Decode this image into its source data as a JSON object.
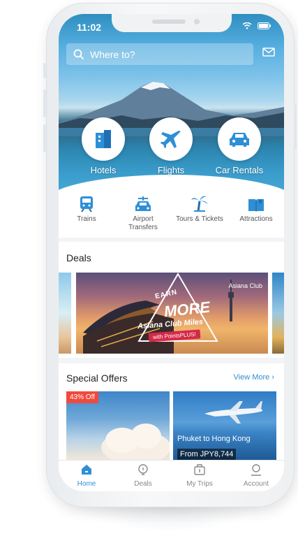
{
  "status": {
    "time": "11:02"
  },
  "search": {
    "placeholder": "Where to?"
  },
  "categories": [
    {
      "label": "Hotels",
      "icon": "hotel-icon"
    },
    {
      "label": "Flights",
      "icon": "plane-icon"
    },
    {
      "label": "Car Rentals",
      "icon": "car-icon"
    }
  ],
  "subcategories": [
    {
      "label": "Trains",
      "icon": "train-icon"
    },
    {
      "label": "Airport\nTransfers",
      "icon": "airport-transfer-icon"
    },
    {
      "label": "Tours & Tickets",
      "icon": "palm-tree-icon"
    },
    {
      "label": "Attractions",
      "icon": "map-book-icon"
    }
  ],
  "deals": {
    "title": "Deals",
    "banner": {
      "earn": "EARN",
      "more": "MORE",
      "headline": "Asiana Club Miles",
      "tag": "with PointsPLUS!",
      "brand": "Asiana Club"
    }
  },
  "special_offers": {
    "title": "Special Offers",
    "view_more": "View More",
    "cards": [
      {
        "badge": "43% Off"
      },
      {
        "route": "Phuket to Hong Kong",
        "price": "From JPY8,744"
      }
    ]
  },
  "tabbar": [
    {
      "label": "Home",
      "icon": "home-icon",
      "active": true
    },
    {
      "label": "Deals",
      "icon": "deals-icon",
      "active": false
    },
    {
      "label": "My Trips",
      "icon": "suitcase-icon",
      "active": false
    },
    {
      "label": "Account",
      "icon": "account-icon",
      "active": false
    }
  ],
  "colors": {
    "accent": "#2f8fd5",
    "discount": "#f04a3e"
  }
}
